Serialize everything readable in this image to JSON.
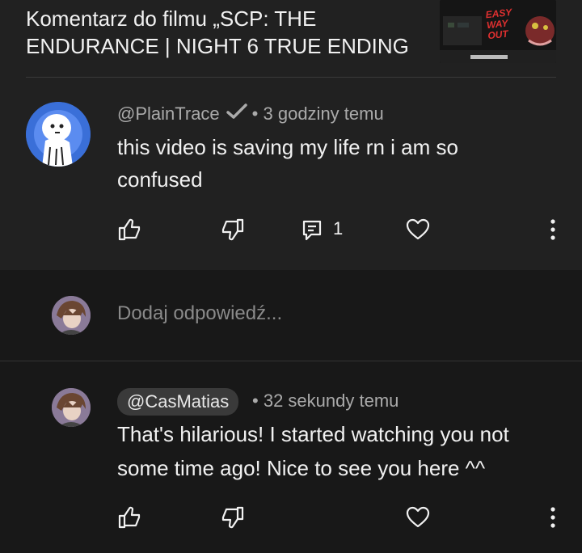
{
  "video": {
    "title": "Komentarz do filmu „SCP: THE ENDURANCE | NIGHT 6 TRUE ENDING ...",
    "thumbnail_text": "EASY WAY OUT"
  },
  "comment": {
    "author": "@PlainTrace",
    "separator": "•",
    "time": "3 godziny temu",
    "text": "this video is saving my life rn i am so confused",
    "reply_count": "1"
  },
  "reply_box": {
    "placeholder": "Dodaj odpowiedź..."
  },
  "reply": {
    "author": "@CasMatias",
    "separator": "•",
    "time": "32 sekundy temu",
    "text": "That's hilarious! I started watching you not some time ago! Nice to see you here ^^"
  },
  "colors": {
    "background": "#212121",
    "background_dark": "#181818",
    "text": "#f1f1f1",
    "muted": "#aaaaaa",
    "avatar_blue": "#3a6fd8"
  },
  "icons": [
    "like-icon",
    "dislike-icon",
    "reply-icon",
    "heart-icon",
    "more-icon",
    "verified-check-icon"
  ]
}
